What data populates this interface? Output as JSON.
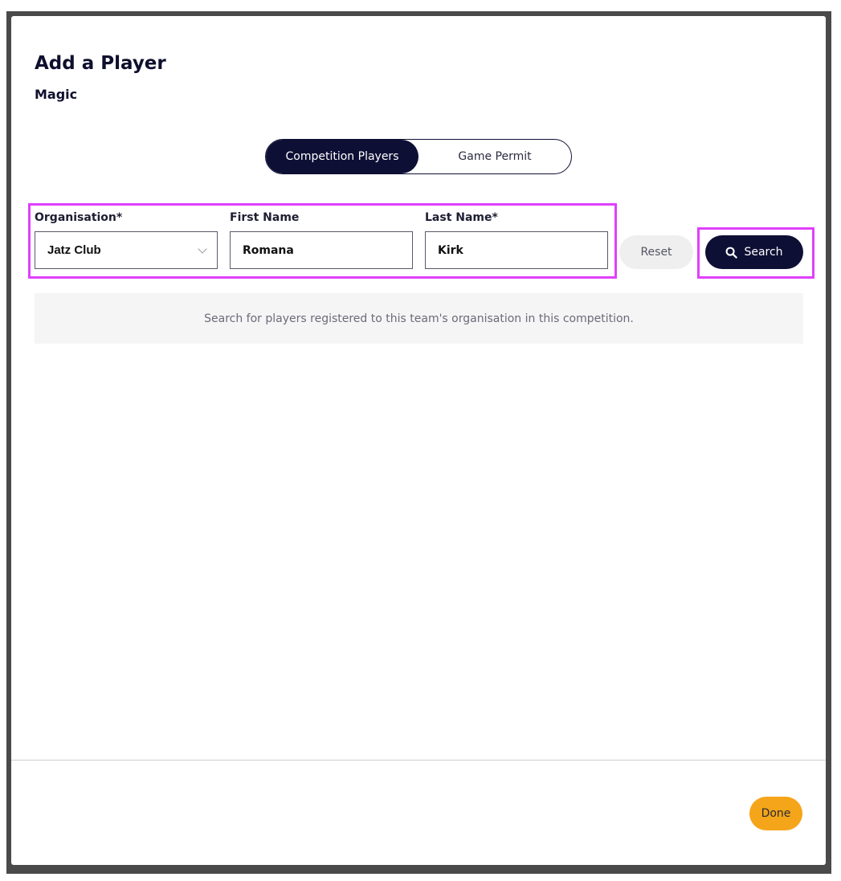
{
  "modal": {
    "title": "Add a Player",
    "subtitle": "Magic"
  },
  "tabs": {
    "items": [
      {
        "label": "Competition Players",
        "active": true
      },
      {
        "label": "Game Permit",
        "active": false
      }
    ]
  },
  "form": {
    "organisation": {
      "label": "Organisation*",
      "value": "Jatz Club"
    },
    "first_name": {
      "label": "First Name",
      "value": "Romana"
    },
    "last_name": {
      "label": "Last Name*",
      "value": "Kirk"
    }
  },
  "actions": {
    "reset_label": "Reset",
    "search_label": "Search"
  },
  "info": {
    "message": "Search for players registered to this team's organisation in this competition."
  },
  "footer": {
    "done_label": "Done"
  },
  "colors": {
    "navy": "#0e0f35",
    "done": "#f5a51a",
    "highlight": "#e040fb"
  }
}
